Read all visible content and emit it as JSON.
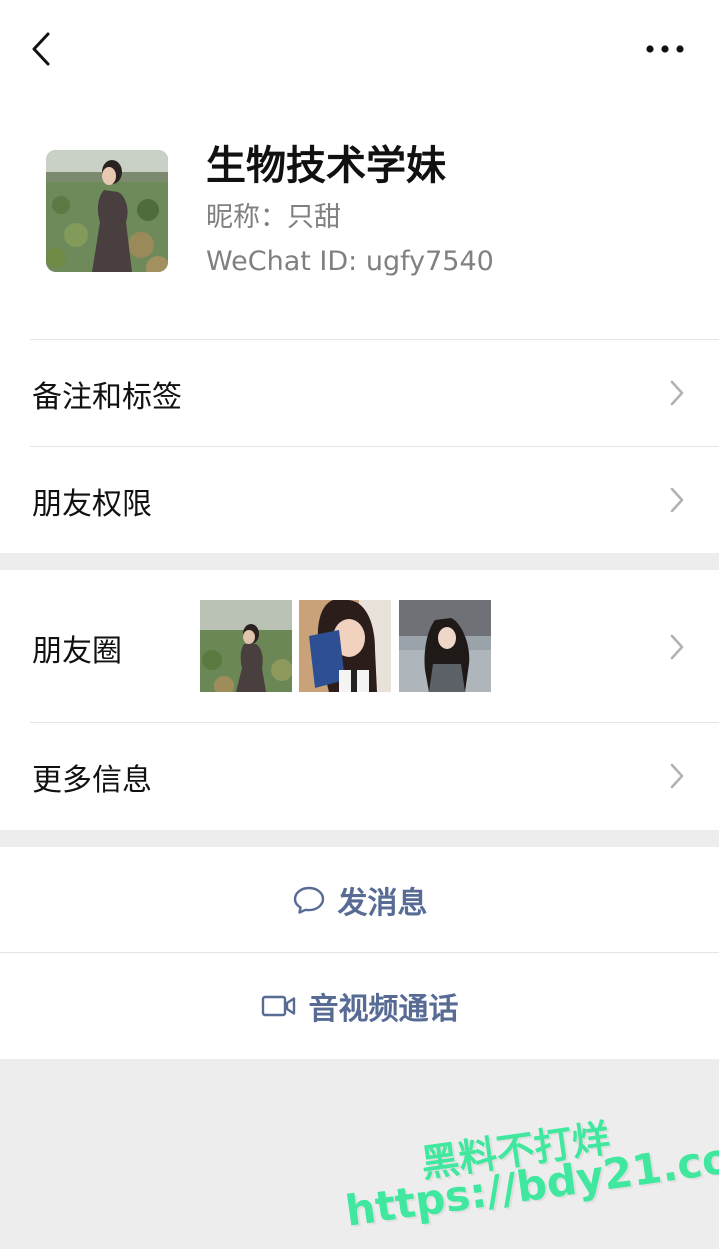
{
  "header": {
    "back_icon": "chevron-left-icon",
    "more_icon": "ellipsis-icon"
  },
  "profile": {
    "remark_name": "生物技术学妹",
    "nickname": "昵称：只甜",
    "wechat_id": "WeChat ID: ugfy7540"
  },
  "menu": {
    "remarks_tags": "备注和标签",
    "friend_permissions": "朋友权限",
    "moments": "朋友圈",
    "more_info": "更多信息"
  },
  "actions": {
    "send_message": "发消息",
    "video_call": "音视频通话"
  },
  "watermark": {
    "line1": "黑料不打烊",
    "line2": "https://bdy21.co"
  },
  "colors": {
    "link_blue": "#576b95",
    "watermark_green": "#3fe89e",
    "background": "#ededed"
  }
}
